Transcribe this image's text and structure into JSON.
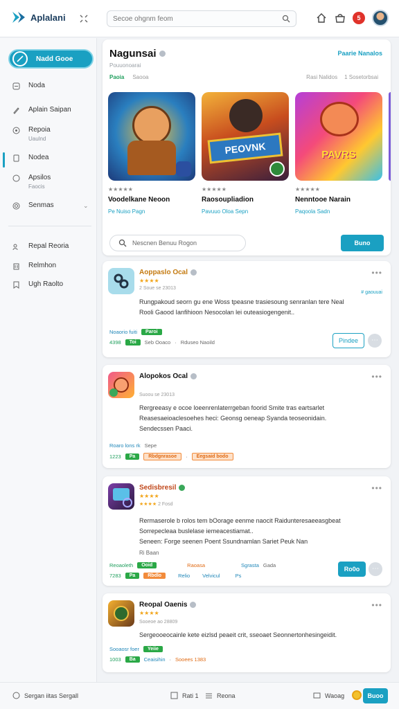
{
  "app": {
    "logo_text": "Aplalani",
    "search_placeholder": "Secoe ohgnm feom",
    "notif_count": "5"
  },
  "sidebar": {
    "new_button": "Nadd Gooe",
    "items": [
      {
        "label": "Noda",
        "sub": ""
      },
      {
        "label": "Aplain Saipan",
        "sub": ""
      },
      {
        "label": "Repoia",
        "sub": "Uaulnd"
      },
      {
        "label": "Nodea",
        "sub": ""
      },
      {
        "label": "Apsilos",
        "sub": "Faocis"
      },
      {
        "label": "Senmas",
        "sub": ""
      },
      {
        "label": "Repal Reoria",
        "sub": ""
      },
      {
        "label": "Relmhon",
        "sub": ""
      },
      {
        "label": "Ugh Raolto",
        "sub": ""
      }
    ]
  },
  "featured": {
    "title": "Nagunsai",
    "subtitle": "Pouuonoarai",
    "link": "Paarie Nanalos",
    "tabs": [
      "Paoia",
      "Saooa"
    ],
    "meta": [
      "Rasi Nalidos",
      "1 Sosetorbsai"
    ],
    "games": [
      {
        "name": "Voodelkane Neoon",
        "stars": "★★★★★",
        "rating_text": "",
        "dev": "Pe Nuiso Pagn",
        "art_text": ""
      },
      {
        "name": "Raosoupliadion",
        "stars": "★★★★★",
        "rating_text": "",
        "dev": "Pavuuo Oloa Sepn",
        "art_text": "PEOVNK"
      },
      {
        "name": "Nenntooe Narain",
        "stars": "★★★★★",
        "rating_text": "",
        "dev": "Paqoola Sadn",
        "art_text": "PAVRS"
      }
    ],
    "search_placeholder": "Nescnen Benuu Rogon",
    "button": "Buno"
  },
  "apps": [
    {
      "name": "Aoppaslo Ocal",
      "stars": "★★★★",
      "meta": "2 Soue se 23013",
      "side_link": "# gaouuai",
      "desc": [
        "Rungpakoud seorn gu ene Woss tpeasne trasiesoung senranlan tere Neal",
        "Rooli Gaood Ianfihioon Nesocolan lei outeasiogengenit.."
      ],
      "row1": [
        "Noaorio fuiti",
        "Paroi"
      ],
      "row2": [
        "4398",
        "Toi",
        "Seb Ooaco",
        "Rduseo Naoild"
      ],
      "btn": "Pindee"
    },
    {
      "name": "Alopokos Ocal",
      "stars": "",
      "meta": "Suoou se 23013",
      "desc": [
        "Rergreeasy e ocoe loeenrenlaterrgeban foorid Smite tras eartsarlet",
        "Reasesaeioaclesoehes heci: Geonsg oeneap Syanda teoseonidain.",
        "Sendecssen    Paaci."
      ],
      "row1": [
        "Roaro lons rk",
        "Sepe"
      ],
      "row2": [
        "1223",
        "Pa",
        "Rbdgnrasoe",
        "Eegsaid bodo"
      ]
    },
    {
      "name": "Sedisbresil",
      "stars": "★★★★",
      "stars2": "★★★★",
      "meta": "2 Fosd",
      "desc": [
        "Rermaserole b rolos tem bOorage eenme naocit Raidunteresaeeasgbeat",
        "Sorrepecleaa buslelase iemeacestiamat..",
        "Seneen: Forge seenen Poent Ssundnamlan Sariet    Peuk    Nan"
      ],
      "extra": "Ri Baan",
      "row1": [
        "Reoaoleth",
        "Ooid",
        "Raoasa",
        "Sgrasta",
        "Gada"
      ],
      "row2": [
        "7283",
        "Pa",
        "Rbdlo",
        "Relio",
        "Velvicul",
        "Ps"
      ],
      "btn": "Ro0o"
    },
    {
      "name": "Reopal Oaenis",
      "stars": "★★★★",
      "meta": "Sooeoe ao 28809",
      "desc": [
        "Sergeooeocainle kete eizlsd peaeit crit, sseoaet Seonnertonhesingeidit."
      ],
      "row1": [
        "Sooaosr foer",
        "Yeiie"
      ],
      "row2": [
        "1003",
        "Ba",
        "Ceaisihin",
        "Sooees 1383"
      ]
    }
  ],
  "bottom": {
    "left": "Sergan iitas Sergall",
    "mid1": "Rati  1",
    "mid2": "Reona",
    "right1": "Waoag",
    "btn": "Buoo"
  },
  "colors": {
    "accent": "#1aa0c2",
    "green": "#2aa846",
    "orange": "#f28b3b"
  }
}
